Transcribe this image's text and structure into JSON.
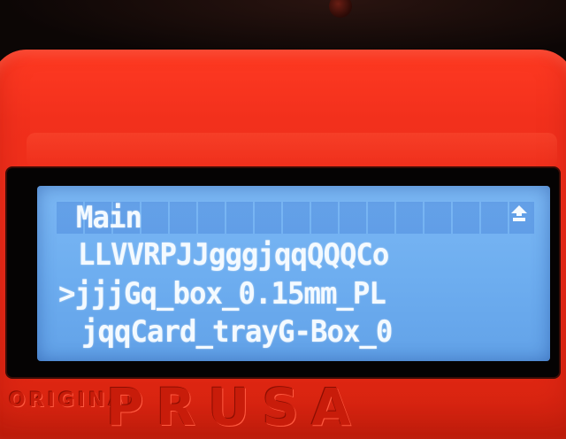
{
  "lcd": {
    "title": "Main",
    "rows": [
      "LLVVRPJJgggjqqQQQCo",
      ">jjjGq_box_0.15mm_PL",
      "jqqCard_trayG-Box_0"
    ],
    "up_icon": "up-arrow-icon"
  },
  "housing": {
    "logo_text": "PRUSA",
    "logo_small_text": "ORIGINAL"
  },
  "colors": {
    "housing": "#f2301c",
    "lcd_background": "#6eaef0",
    "lcd_text": "#f4faff",
    "bezel": "#050303"
  }
}
